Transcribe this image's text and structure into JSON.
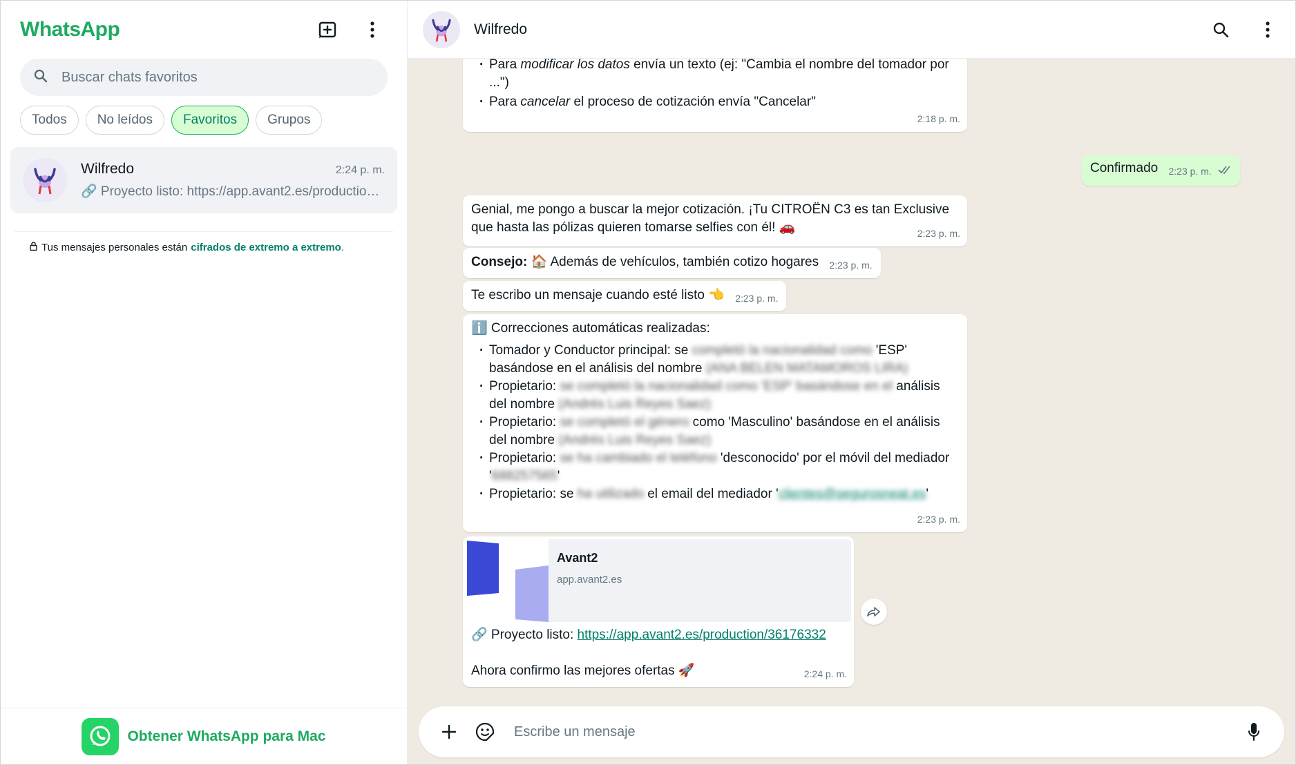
{
  "sidebar": {
    "brand": "WhatsApp",
    "search_placeholder": "Buscar chats favoritos",
    "filters": [
      {
        "label": "Todos",
        "active": false
      },
      {
        "label": "No leídos",
        "active": false
      },
      {
        "label": "Favoritos",
        "active": true
      },
      {
        "label": "Grupos",
        "active": false
      }
    ],
    "chats": [
      {
        "name": "Wilfredo",
        "time": "2:24 p. m.",
        "preview": "🔗 Proyecto listo: https://app.avant2.es/production/36176332"
      }
    ],
    "encryption_text": "Tus mensajes personales están",
    "encryption_link": "cifrados de extremo a extremo",
    "encryption_end": ".",
    "get_app": "Obtener WhatsApp para Mac"
  },
  "chat": {
    "contact_name": "Wilfredo",
    "composer_placeholder": "Escribe un mensaje",
    "messages": {
      "m1": {
        "li1_a": "Para ",
        "li1_em": "modificar los datos",
        "li1_b": " envía un texto (ej: \"Cambia el nombre del tomador por ...\")",
        "li2_a": "Para ",
        "li2_em": "cancelar",
        "li2_b": " el proceso de cotización envía \"Cancelar\"",
        "time": "2:18 p. m."
      },
      "m2": {
        "text": "Confirmado",
        "time": "2:23 p. m."
      },
      "m3": {
        "text": "Genial, me pongo a buscar la mejor cotización. ¡Tu CITROËN C3 es tan Exclusive que hasta las pólizas quieren tomarse selfies con él! 🚗",
        "time": "2:23 p. m."
      },
      "m4": {
        "bold": "Consejo:",
        "text": " 🏠 Además de vehículos, también cotizo hogares",
        "time": "2:23 p. m."
      },
      "m5": {
        "text": "Te escribo un mensaje cuando esté listo 👈",
        "time": "2:23 p. m."
      },
      "m6": {
        "title": "ℹ️ Correcciones automáticas realizadas:",
        "items": [
          {
            "a": "Tomador y Conductor principal: se ",
            "blur1": "completó la nacionalidad como",
            "b": " 'ESP' basándose en el análisis del nombre ",
            "blur2": "(ANA BELEN MATAMOROS LIRA)",
            "c": ""
          },
          {
            "a": "Propietario: ",
            "blur1": "se completó la nacionalidad como 'ESP' basándose en el",
            "b": " análisis del nombre ",
            "blur2": "(Andrés Luis Reyes Saez)",
            "c": ""
          },
          {
            "a": "Propietario: ",
            "blur1": "se completó el género",
            "b": " como 'Masculino' basándose en el análisis del nombre ",
            "blur2": "(Andrés Luis Reyes Saez)",
            "c": ""
          },
          {
            "a": "Propietario: ",
            "blur1": "se ha cambiado el teléfono",
            "b": " 'desconocido' por el móvil del mediador '",
            "blur2": "688257565",
            "c": "'"
          },
          {
            "a": "Propietario: se ",
            "blur1": "ha utilizado",
            "b": " el email del mediador '",
            "blur2": "clientes@segurosneat.es",
            "c": "'"
          }
        ],
        "time": "2:23 p. m."
      },
      "m7": {
        "preview_title": "Avant2",
        "preview_domain": "app.avant2.es",
        "link_prefix": "🔗 Proyecto listo: ",
        "link": "https://app.avant2.es/production/36176332",
        "follow": "Ahora confirmo las mejores ofertas 🚀",
        "time": "2:24 p. m."
      }
    }
  },
  "colors": {
    "brand_green": "#1daa61",
    "outgoing_bubble": "#d9fdd3",
    "chat_background": "#efeae2",
    "link_green": "#008069"
  },
  "icons": [
    "new-chat-icon",
    "menu-dots-icon",
    "search-icon",
    "link-icon",
    "lock-icon",
    "whatsapp-logo-icon",
    "plus-icon",
    "sticker-icon",
    "mic-icon",
    "forward-icon",
    "double-check-icon"
  ]
}
